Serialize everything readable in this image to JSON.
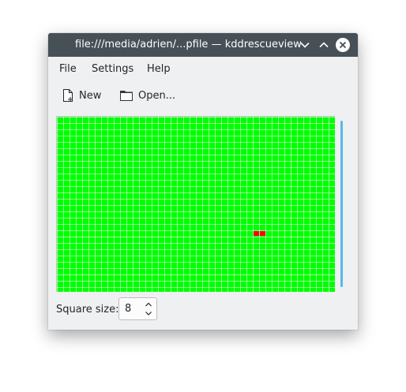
{
  "window": {
    "title": "file:///media/adrien/...pfile — kddrescueview"
  },
  "titlebar_buttons": {
    "minimize_icon": "chevron-down-icon",
    "maximize_icon": "chevron-up-icon",
    "close_icon": "close-icon"
  },
  "menubar": {
    "items": [
      {
        "label": "File"
      },
      {
        "label": "Settings"
      },
      {
        "label": "Help"
      }
    ]
  },
  "toolbar": {
    "new_label": "New",
    "new_icon": "new-document-icon",
    "open_label": "Open...",
    "open_icon": "folder-open-icon"
  },
  "block_map": {
    "columns": 44,
    "rows": 28,
    "good_color": "#00ff00",
    "bad_color": "#ff0000",
    "bad_blocks": [
      {
        "row": 18,
        "col": 31
      },
      {
        "row": 18,
        "col": 32
      }
    ]
  },
  "square_size": {
    "label": "Square size:",
    "value": "8"
  },
  "colors": {
    "titlebar": "#475057",
    "window_bg": "#eff0f1",
    "scrollbar_accent": "#3daee9"
  }
}
